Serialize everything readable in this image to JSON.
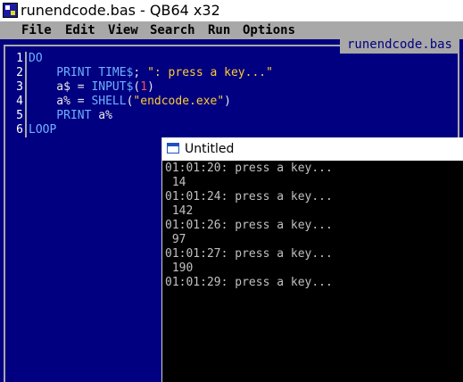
{
  "window": {
    "title": "runendcode.bas - QB64 x32"
  },
  "menu": [
    "File",
    "Edit",
    "View",
    "Search",
    "Run",
    "Options"
  ],
  "editor": {
    "file_tab": "runendcode.bas",
    "line_numbers": [
      "1",
      "2",
      "3",
      "4",
      "5",
      "6"
    ],
    "lines": [
      [
        {
          "t": "DO",
          "c": "kw"
        }
      ],
      [
        {
          "t": "    PRINT TIME$",
          "c": "kw"
        },
        {
          "t": "; ",
          "c": "op"
        },
        {
          "t": "\": press a key...\"",
          "c": "str"
        }
      ],
      [
        {
          "t": "    a$ = ",
          "c": "id"
        },
        {
          "t": "INPUT$",
          "c": "kw"
        },
        {
          "t": "(",
          "c": "op"
        },
        {
          "t": "1",
          "c": "num"
        },
        {
          "t": ")",
          "c": "op"
        }
      ],
      [
        {
          "t": "    a% = ",
          "c": "id"
        },
        {
          "t": "SHELL",
          "c": "kw"
        },
        {
          "t": "(",
          "c": "op"
        },
        {
          "t": "\"endcode.exe\"",
          "c": "str"
        },
        {
          "t": ")",
          "c": "op"
        }
      ],
      [
        {
          "t": "    PRINT ",
          "c": "kw"
        },
        {
          "t": "a%",
          "c": "id"
        }
      ],
      [
        {
          "t": "LOOP",
          "c": "kw"
        }
      ]
    ]
  },
  "console": {
    "title": "Untitled",
    "output": [
      "01:01:20: press a key...",
      " 14",
      "01:01:24: press a key...",
      " 142",
      "01:01:26: press a key...",
      " 97",
      "01:01:27: press a key...",
      " 190",
      "01:01:29: press a key..."
    ]
  },
  "colors": {
    "editor_bg": "#000080",
    "keyword": "#70b0ff",
    "string": "#ffcc33",
    "number": "#ff5050",
    "menu_bg": "#a8a8a8"
  }
}
